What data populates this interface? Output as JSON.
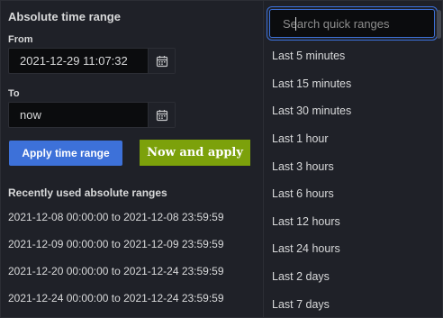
{
  "absolute": {
    "heading": "Absolute time range",
    "from_label": "From",
    "from_value": "2021-12-29 11:07:32",
    "to_label": "To",
    "to_value": "now",
    "apply_label": "Apply time range",
    "now_apply_label": "Now and apply"
  },
  "recent": {
    "heading": "Recently used absolute ranges",
    "items": [
      "2021-12-08 00:00:00 to 2021-12-08 23:59:59",
      "2021-12-09 00:00:00 to 2021-12-09 23:59:59",
      "2021-12-20 00:00:00 to 2021-12-24 23:59:59",
      "2021-12-24 00:00:00 to 2021-12-24 23:59:59"
    ]
  },
  "quick": {
    "search_placeholder": "Search quick ranges",
    "items": [
      "Last 5 minutes",
      "Last 15 minutes",
      "Last 30 minutes",
      "Last 1 hour",
      "Last 3 hours",
      "Last 6 hours",
      "Last 12 hours",
      "Last 24 hours",
      "Last 2 days",
      "Last 7 days"
    ]
  },
  "icons": {
    "calendar": "calendar-icon",
    "search": "search-icon"
  },
  "colors": {
    "background": "#1f2128",
    "input_background": "#0b0c0e",
    "primary_button": "#3d71d9",
    "now_button": "#7ca10b",
    "text": "#d8d9da"
  }
}
